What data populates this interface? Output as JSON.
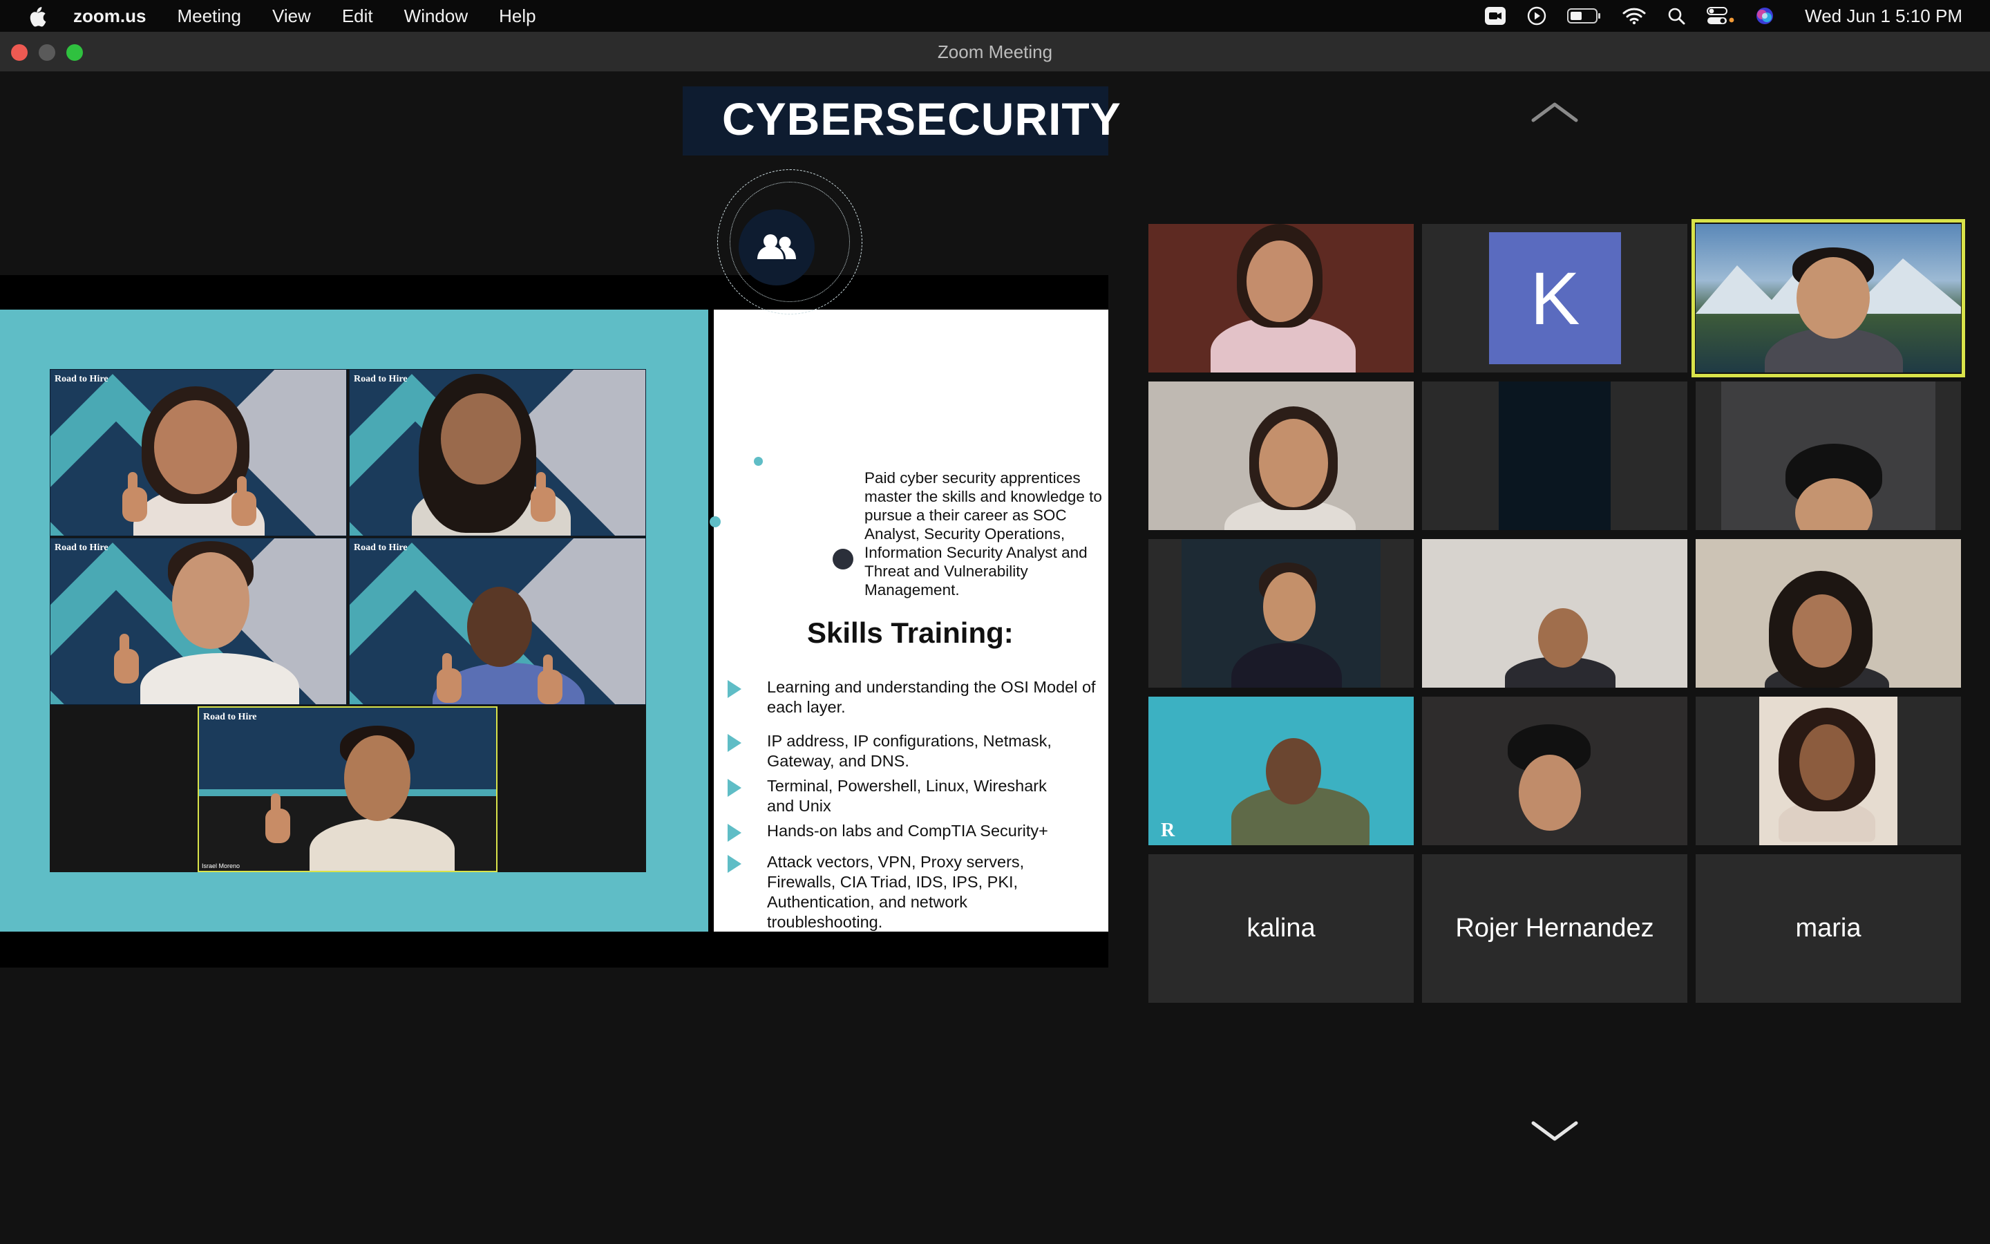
{
  "menubar": {
    "app_name": "zoom.us",
    "items": [
      "Meeting",
      "View",
      "Edit",
      "Window",
      "Help"
    ],
    "datetime": "Wed Jun 1  5:10 PM"
  },
  "window": {
    "title": "Zoom Meeting"
  },
  "shared_screen": {
    "gallery_logo": "Road to Hire",
    "presenter_name": "Israel Moreno",
    "slide": {
      "title": "CYBERSECURITY",
      "description": "Paid cyber security apprentices master the skills and knowledge to pursue a their career as SOC Analyst, Security Operations, Information Security Analyst and Threat and Vulnerability Management.",
      "skills_heading": "Skills Training:",
      "bullets": [
        "Learning and understanding the OSI Model of each layer.",
        "IP address, IP configurations, Netmask, Gateway, and DNS.",
        "Terminal, Powershell, Linux, Wireshark and Unix",
        "Hands-on labs and CompTIA Security+",
        "Attack vectors, VPN, Proxy servers, Firewalls, CIA Triad, IDS, IPS, PKI, Authentication, and network troubleshooting."
      ]
    }
  },
  "participants": {
    "avatar_initial": "K",
    "named_tiles": [
      "kalina",
      "Rojer Hernandez",
      "maria"
    ]
  },
  "colors": {
    "active_speaker": "#d9e34a",
    "slide_accent": "#5fbdc6",
    "slide_navy": "#0e1c30",
    "avatar_bg": "#5a6bbf"
  },
  "icons": [
    "apple-icon",
    "zoom-status-icon",
    "play-icon",
    "battery-icon",
    "wifi-icon",
    "spotlight-search-icon",
    "control-center-icon",
    "siri-icon",
    "scroll-up-chevron-icon",
    "scroll-down-chevron-icon",
    "people-icon"
  ]
}
